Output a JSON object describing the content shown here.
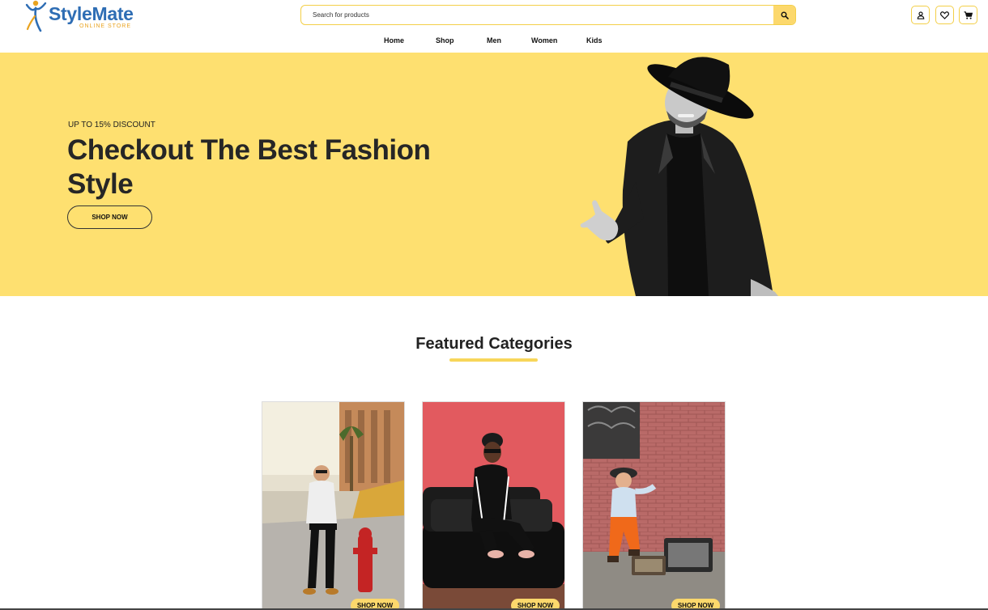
{
  "brand": {
    "name": "StyleMate",
    "tagline": "ONLINE STORE",
    "primary_color": "#2e6db4",
    "accent_color": "#e9a320"
  },
  "search": {
    "placeholder": "Search for products",
    "value": "",
    "button_icon": "search-icon"
  },
  "header_icons": [
    {
      "name": "user-icon"
    },
    {
      "name": "heart-icon"
    },
    {
      "name": "cart-icon"
    }
  ],
  "nav": {
    "items": [
      {
        "label": "Home"
      },
      {
        "label": "Shop"
      },
      {
        "label": "Men"
      },
      {
        "label": "Women"
      },
      {
        "label": "Kids"
      }
    ]
  },
  "hero": {
    "eyebrow": "UP TO 15% DISCOUNT",
    "title": "Checkout The Best Fashion Style",
    "button_label": "SHOP NOW",
    "background_color": "#fee070"
  },
  "featured": {
    "title": "Featured Categories",
    "cards": [
      {
        "button_label": "SHOP NOW"
      },
      {
        "button_label": "SHOP NOW"
      },
      {
        "button_label": "SHOP NOW"
      }
    ]
  },
  "colors": {
    "accent_yellow": "#fcd86c",
    "border_yellow": "#f3cf48"
  }
}
